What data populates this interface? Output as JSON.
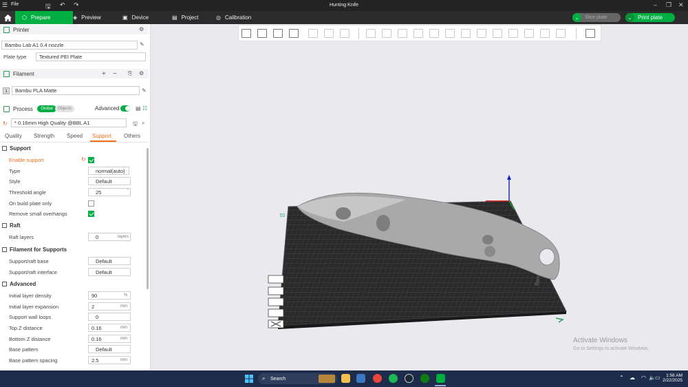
{
  "titlebar": {
    "file_menu": "File",
    "window_title": "Hunting Knife"
  },
  "nav": {
    "tabs": [
      {
        "label": "Prepare",
        "icon": "cube-icon"
      },
      {
        "label": "Preview",
        "icon": "layers-icon"
      },
      {
        "label": "Device",
        "icon": "monitor-icon"
      },
      {
        "label": "Project",
        "icon": "folder-icon"
      },
      {
        "label": "Calibration",
        "icon": "gauge-icon"
      }
    ],
    "slice_label": "Slice plate",
    "print_label": "Print plate"
  },
  "printer": {
    "section_label": "Printer",
    "name": "Bambu Lab A1 0.4 nozzle",
    "plate_type_label": "Plate type",
    "plate_type_value": "Textured PEI Plate"
  },
  "filament": {
    "section_label": "Filament",
    "slot_number": "1",
    "name": "Bambu PLA Matte"
  },
  "process": {
    "section_label": "Process",
    "toggle_global": "Global",
    "toggle_objects": "Objects",
    "advanced_label": "Advanced",
    "preset": "* 0.16mm High Quality @BBL A1",
    "tabs": [
      "Quality",
      "Strength",
      "Speed",
      "Support",
      "Others"
    ],
    "active_tab": "Support"
  },
  "support_settings": {
    "group_support": "Support",
    "enable_support_label": "Enable support",
    "type_label": "Type",
    "type_value": "normal(auto)",
    "style_label": "Style",
    "style_value": "Default",
    "threshold_label": "Threshold angle",
    "threshold_value": "25",
    "threshold_unit": "°",
    "on_build_plate_label": "On build plate only",
    "remove_overhangs_label": "Remove small overhangs",
    "group_raft": "Raft",
    "raft_layers_label": "Raft layers",
    "raft_layers_value": "0",
    "raft_layers_unit": "layers",
    "group_filament": "Filament for Supports",
    "raft_base_label": "Support/raft base",
    "raft_base_value": "Default",
    "raft_interface_label": "Support/raft interface",
    "raft_interface_value": "Default",
    "group_advanced": "Advanced",
    "initial_density_label": "Initial layer density",
    "initial_density_value": "90",
    "initial_density_unit": "%",
    "initial_expansion_label": "Initial layer expansion",
    "initial_expansion_value": "2",
    "initial_expansion_unit": "mm",
    "wall_loops_label": "Support wall loops",
    "wall_loops_value": "0",
    "top_z_label": "Top Z distance",
    "top_z_value": "0.16",
    "top_z_unit": "mm",
    "bottom_z_label": "Bottom Z distance",
    "bottom_z_value": "0.16",
    "bottom_z_unit": "mm",
    "base_pattern_label": "Base pattern",
    "base_pattern_value": "Default",
    "base_spacing_label": "Base pattern spacing",
    "base_spacing_value": "2.5",
    "base_spacing_unit": "mm",
    "checkbox_states": {
      "enable_support": true,
      "on_build_plate": false,
      "remove_overhangs": true
    }
  },
  "viewport": {
    "plate_number": "01",
    "plate_brand": "Bambu"
  },
  "watermark": {
    "line1": "Activate Windows",
    "line2": "Go to Settings to activate Windows."
  },
  "taskbar": {
    "search_placeholder": "Search",
    "time": "1:56 AM",
    "date": "2/22/2025"
  },
  "colors": {
    "accent": "#00ae42",
    "active_tab": "#f06f1c",
    "titlebar": "#232323",
    "taskbar": "#1c2c4a"
  }
}
